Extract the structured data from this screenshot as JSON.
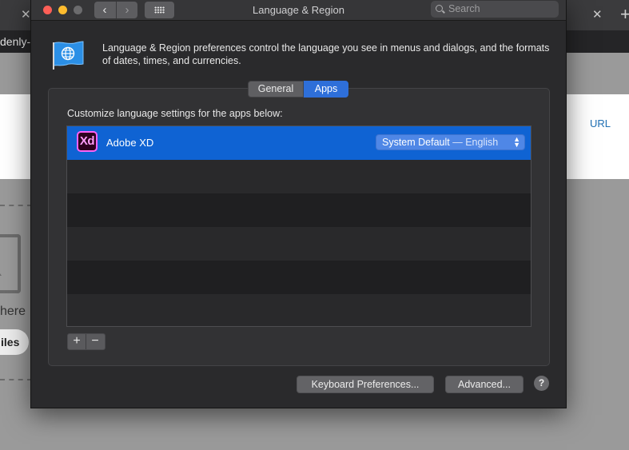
{
  "background": {
    "address_text": "denly-i",
    "url_label": "URL",
    "drop_hint": "here",
    "files_button": "iles"
  },
  "window": {
    "title": "Language & Region",
    "search_placeholder": "Search",
    "description": "Language & Region preferences control the language you see in menus and dialogs, and the formats of dates, times, and currencies.",
    "tabs": [
      {
        "label": "General",
        "selected": false
      },
      {
        "label": "Apps",
        "selected": true
      }
    ],
    "apps_panel": {
      "label": "Customize language settings for the apps below:",
      "apps": [
        {
          "icon_text": "Xd",
          "name": "Adobe XD",
          "language": "System Default",
          "language_detail": "— English"
        }
      ],
      "add_symbol": "+",
      "remove_symbol": "−"
    },
    "buttons": {
      "keyboard": "Keyboard Preferences...",
      "advanced": "Advanced...",
      "help": "?"
    }
  },
  "colors": {
    "selection_blue": "#0f63d3",
    "tab_selected": "#2e6fd9",
    "window_bg": "#2a2a2c"
  }
}
